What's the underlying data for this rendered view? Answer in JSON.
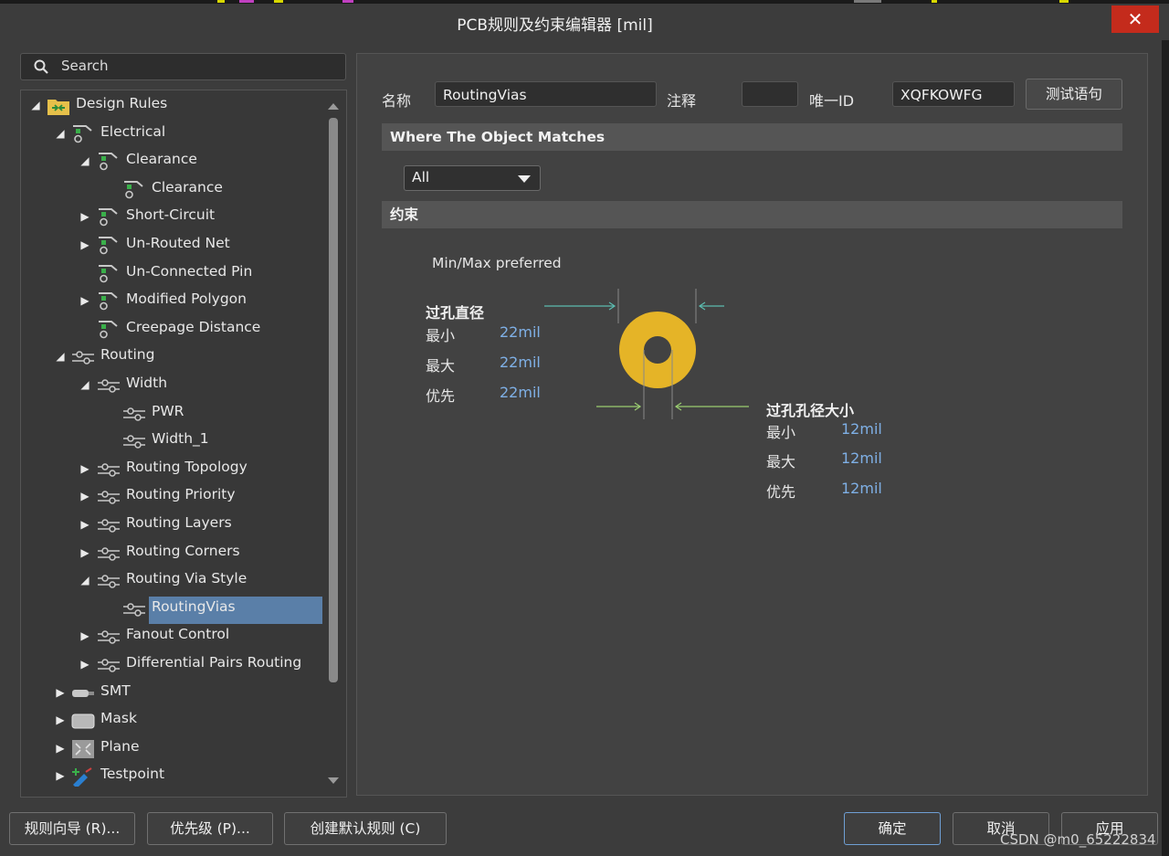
{
  "window": {
    "title": "PCB规则及约束编辑器 [mil]",
    "close_glyph": "✕"
  },
  "search": {
    "placeholder": "Search"
  },
  "tree": [
    {
      "label": "Design Rules",
      "toggle": "◢",
      "level": 0,
      "icon": "rules-folder-icon"
    },
    {
      "label": "Electrical",
      "toggle": "◢",
      "level": 1,
      "icon": "electrical-rule-icon"
    },
    {
      "label": "Clearance",
      "toggle": "◢",
      "level": 2,
      "icon": "electrical-rule-icon"
    },
    {
      "label": "Clearance",
      "toggle": "",
      "level": 3,
      "icon": "electrical-rule-icon"
    },
    {
      "label": "Short-Circuit",
      "toggle": "▶",
      "level": 2,
      "icon": "electrical-rule-icon"
    },
    {
      "label": "Un-Routed Net",
      "toggle": "▶",
      "level": 2,
      "icon": "electrical-rule-icon"
    },
    {
      "label": "Un-Connected Pin",
      "toggle": "",
      "level": 2,
      "icon": "electrical-rule-icon"
    },
    {
      "label": "Modified Polygon",
      "toggle": "▶",
      "level": 2,
      "icon": "electrical-rule-icon"
    },
    {
      "label": "Creepage Distance",
      "toggle": "",
      "level": 2,
      "icon": "electrical-rule-icon"
    },
    {
      "label": "Routing",
      "toggle": "◢",
      "level": 1,
      "icon": "routing-rule-icon"
    },
    {
      "label": "Width",
      "toggle": "◢",
      "level": 2,
      "icon": "routing-rule-icon"
    },
    {
      "label": "PWR",
      "toggle": "",
      "level": 3,
      "icon": "routing-rule-icon"
    },
    {
      "label": "Width_1",
      "toggle": "",
      "level": 3,
      "icon": "routing-rule-icon"
    },
    {
      "label": "Routing Topology",
      "toggle": "▶",
      "level": 2,
      "icon": "routing-rule-icon"
    },
    {
      "label": "Routing Priority",
      "toggle": "▶",
      "level": 2,
      "icon": "routing-rule-icon"
    },
    {
      "label": "Routing Layers",
      "toggle": "▶",
      "level": 2,
      "icon": "routing-rule-icon"
    },
    {
      "label": "Routing Corners",
      "toggle": "▶",
      "level": 2,
      "icon": "routing-rule-icon"
    },
    {
      "label": "Routing Via Style",
      "toggle": "◢",
      "level": 2,
      "icon": "routing-rule-icon"
    },
    {
      "label": "RoutingVias",
      "toggle": "",
      "level": 3,
      "icon": "routing-rule-icon",
      "selected": true
    },
    {
      "label": "Fanout Control",
      "toggle": "▶",
      "level": 2,
      "icon": "routing-rule-icon"
    },
    {
      "label": "Differential Pairs Routing",
      "toggle": "▶",
      "level": 2,
      "icon": "routing-rule-icon"
    },
    {
      "label": "SMT",
      "toggle": "▶",
      "level": 1,
      "icon": "smt-rule-icon"
    },
    {
      "label": "Mask",
      "toggle": "▶",
      "level": 1,
      "icon": "mask-rule-icon"
    },
    {
      "label": "Plane",
      "toggle": "▶",
      "level": 1,
      "icon": "plane-rule-icon"
    },
    {
      "label": "Testpoint",
      "toggle": "▶",
      "level": 1,
      "icon": "testpoint-rule-icon"
    }
  ],
  "rule": {
    "name_label": "名称",
    "name_value": "RoutingVias",
    "comment_label": "注释",
    "comment_value": "",
    "id_label": "唯一ID",
    "id_value": "XQFKOWFG",
    "test_button": "测试语句"
  },
  "where": {
    "header": "Where The Object Matches",
    "scope_value": "All"
  },
  "constraints": {
    "header": "约束",
    "mode": "Min/Max preferred",
    "via_diameter": {
      "title": "过孔直径",
      "min_label": "最小",
      "min": "22mil",
      "max_label": "最大",
      "max": "22mil",
      "pref_label": "优先",
      "pref": "22mil"
    },
    "hole_size": {
      "title": "过孔孔径大小",
      "min_label": "最小",
      "min": "12mil",
      "max_label": "最大",
      "max": "12mil",
      "pref_label": "优先",
      "pref": "12mil"
    },
    "colors": {
      "via_pad": "#e5b427",
      "arrow_teal": "#5bbcb0",
      "arrow_green": "#9acd70"
    }
  },
  "footer": {
    "wizard": "规则向导 (R)...",
    "priority": "优先级 (P)...",
    "create_default": "创建默认规则 (C)",
    "ok": "确定",
    "cancel": "取消",
    "apply": "应用"
  },
  "watermark": "CSDN @m0_65222834"
}
